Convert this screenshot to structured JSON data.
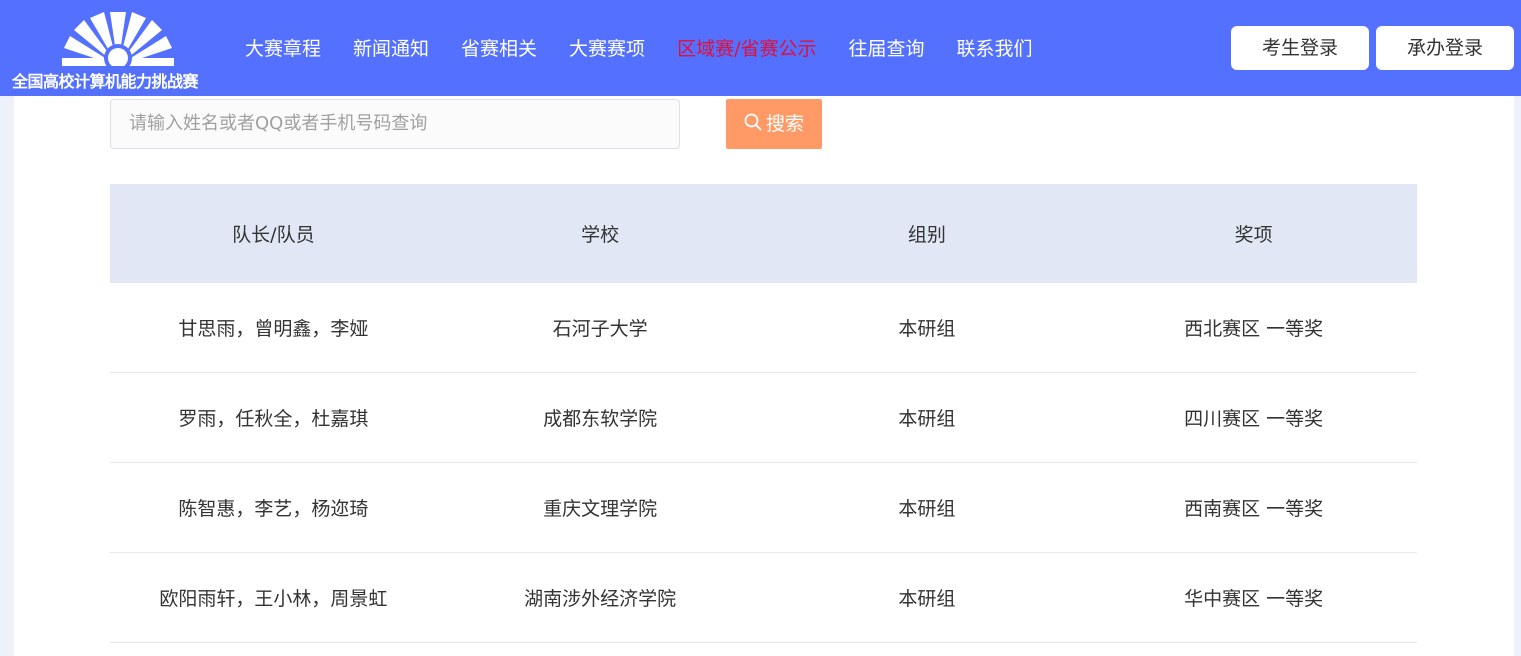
{
  "header": {
    "logo_text": "全国高校计算机能力挑战赛",
    "nav": [
      {
        "label": "大赛章程",
        "active": false
      },
      {
        "label": "新闻通知",
        "active": false
      },
      {
        "label": "省赛相关",
        "active": false
      },
      {
        "label": "大赛赛项",
        "active": false
      },
      {
        "label": "区域赛/省赛公示",
        "active": true
      },
      {
        "label": "往届查询",
        "active": false
      },
      {
        "label": "联系我们",
        "active": false
      }
    ],
    "student_login": "考生登录",
    "host_login": "承办登录"
  },
  "search": {
    "placeholder": "请输入姓名或者QQ或者手机号码查询",
    "value": "",
    "button_label": "搜索",
    "button_icon": "search-icon"
  },
  "table": {
    "columns": [
      "队长/队员",
      "学校",
      "组别",
      "奖项"
    ],
    "rows": [
      [
        "甘思雨，曾明鑫，李娅",
        "石河子大学",
        "本研组",
        "西北赛区 一等奖"
      ],
      [
        "罗雨，任秋全，杜嘉琪",
        "成都东软学院",
        "本研组",
        "四川赛区 一等奖"
      ],
      [
        "陈智惠，李艺，杨迩琦",
        "重庆文理学院",
        "本研组",
        "西南赛区 一等奖"
      ],
      [
        "欧阳雨轩，王小林，周景虹",
        "湖南涉外经济学院",
        "本研组",
        "华中赛区 一等奖"
      ]
    ]
  },
  "colors": {
    "header_bg": "#5470ff",
    "active_nav": "#e0103a",
    "search_button": "#ff9a66",
    "table_header_bg": "#e1e7f5"
  }
}
